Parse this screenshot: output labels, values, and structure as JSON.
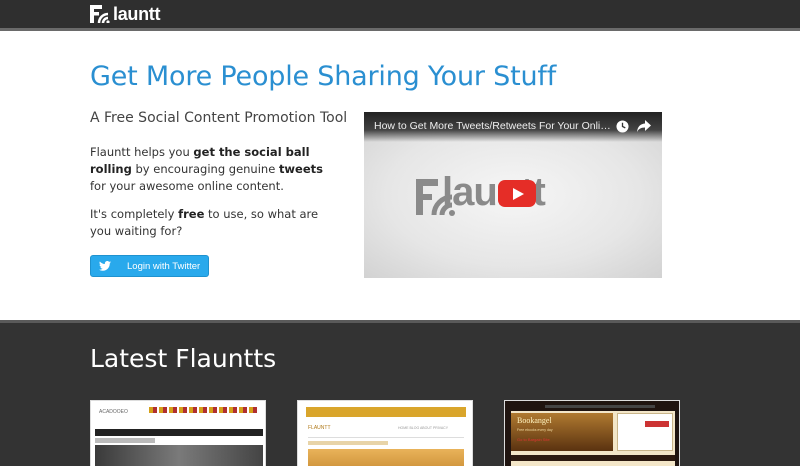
{
  "header": {
    "logo_text": "launtt"
  },
  "hero": {
    "headline": "Get More People Sharing Your Stuff",
    "subhead": "A Free Social Content Promotion Tool",
    "para1": {
      "t1": "Flauntt helps you ",
      "b1": "get the social ball rolling",
      "t2": " by encouraging genuine ",
      "b2": "tweets",
      "t3": " for your awesome online content."
    },
    "para2": {
      "t1": "It's completely ",
      "b1": "free",
      "t2": " to use, so what are you waiting for?"
    },
    "login_label": "Login with Twitter"
  },
  "video": {
    "title": "How to Get More Tweets/Retweets For Your Online Content",
    "logo_text": "launtt"
  },
  "latest": {
    "title": "Latest Flauntts",
    "thumbs": [
      {
        "logo": "ACADOOEO"
      },
      {
        "logo": "FLAUNTT",
        "nav": "HOME  BLOG  ABOUT  PRIVACY"
      },
      {
        "title": "Bookangel",
        "sub": "Free ebooks every day",
        "link": "Go to Bargain Site"
      }
    ]
  },
  "colors": {
    "accent": "#2a8fd1",
    "twitter": "#29a9ec",
    "youtube_red": "#e52d27",
    "dark_bg": "#333333"
  }
}
